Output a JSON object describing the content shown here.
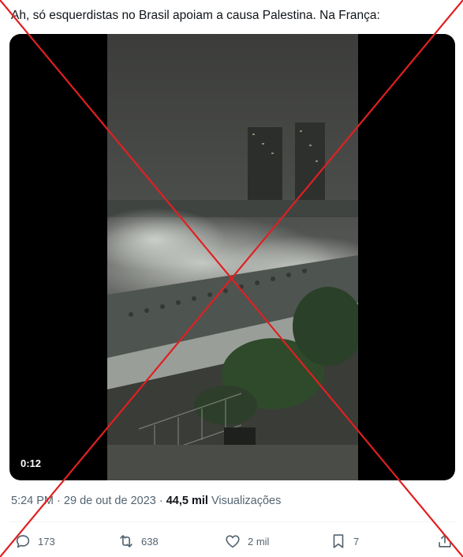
{
  "tweet": {
    "text": "Ah, só esquerdistas no Brasil apoiam a causa Palestina. Na França:"
  },
  "video": {
    "duration": "0:12"
  },
  "meta": {
    "time": "5:24 PM",
    "separator": "·",
    "date": "29 de out de 2023",
    "views_count": "44,5 mil",
    "views_label": "Visualizações"
  },
  "actions": {
    "replies": "173",
    "retweets": "638",
    "likes": "2 mil",
    "bookmarks": "7"
  },
  "colors": {
    "overlay_x": "#e02020",
    "secondary_text": "#536471",
    "primary_text": "#0f1419"
  },
  "icons": [
    "reply-icon",
    "retweet-icon",
    "like-icon",
    "bookmark-icon",
    "share-icon"
  ]
}
